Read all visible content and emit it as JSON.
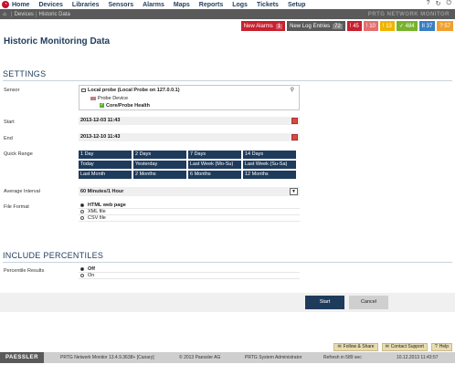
{
  "nav": {
    "items": [
      "Home",
      "Devices",
      "Libraries",
      "Sensors",
      "Alarms",
      "Maps",
      "Reports",
      "Logs",
      "Tickets",
      "Setup"
    ],
    "right_icons": [
      "?",
      "↻",
      "⏻"
    ]
  },
  "breadcrumb": {
    "items": [
      "Devices",
      "Historic Data"
    ],
    "brand": "PRTG NETWORK MONITOR"
  },
  "badges": [
    {
      "label": "New Alarms",
      "count": "1",
      "color": "#c8202f"
    },
    {
      "label": "New Log Entries",
      "count": "72",
      "color": "#5a5a5a"
    },
    {
      "label": "! 45",
      "count": "",
      "color": "#c8202f"
    },
    {
      "label": "! 10",
      "count": "",
      "color": "#e46f6f"
    },
    {
      "label": "! 13",
      "count": "",
      "color": "#f0b400"
    },
    {
      "label": "✓ 484",
      "count": "",
      "color": "#77b32b"
    },
    {
      "label": "II 37",
      "count": "",
      "color": "#3a7fc1"
    },
    {
      "label": "? 57",
      "count": "",
      "color": "#f0a030"
    }
  ],
  "page": {
    "title": "Historic Monitoring Data"
  },
  "settings": {
    "heading": "SETTINGS",
    "sensor_label": "Sensor",
    "sensor_tree": {
      "probe": "Local probe (Local Probe on 127.0.0.1)",
      "device": "Probe Device",
      "sensor": "Core/Probe Health"
    },
    "start_label": "Start",
    "start_value": "2013-12-03 11:43",
    "end_label": "End",
    "end_value": "2013-12-10 11:43",
    "quick_range_label": "Quick Range",
    "quick_ranges": [
      "1 Day",
      "2 Days",
      "7 Days",
      "14 Days",
      "Today",
      "Yesterday",
      "Last Week (Mo-Su)",
      "Last Week (Su-Sa)",
      "Last Month",
      "2 Months",
      "6 Months",
      "12 Months"
    ],
    "avg_label": "Average Interval",
    "avg_value": "60 Minutes/1 Hour",
    "format_label": "File Format",
    "formats": [
      "HTML web page",
      "XML file",
      "CSV file"
    ]
  },
  "percentiles": {
    "heading": "INCLUDE PERCENTILES",
    "label": "Percentile Results",
    "options": [
      "Off",
      "On"
    ]
  },
  "actions": {
    "start": "Start",
    "cancel": "Cancel"
  },
  "help": {
    "follow": "Follow & Share",
    "contact": "Contact Support",
    "help": "Help"
  },
  "footer": {
    "brand": "PAESSLER",
    "version": "PRTG Network Monitor 13.4.9.3638+ [Canary]",
    "copyright": "© 2013 Paessler AG",
    "user": "PRTG System Administrator",
    "refresh": "Refresh in 589 sec",
    "timestamp": "10.12.2013 11:43:57"
  }
}
